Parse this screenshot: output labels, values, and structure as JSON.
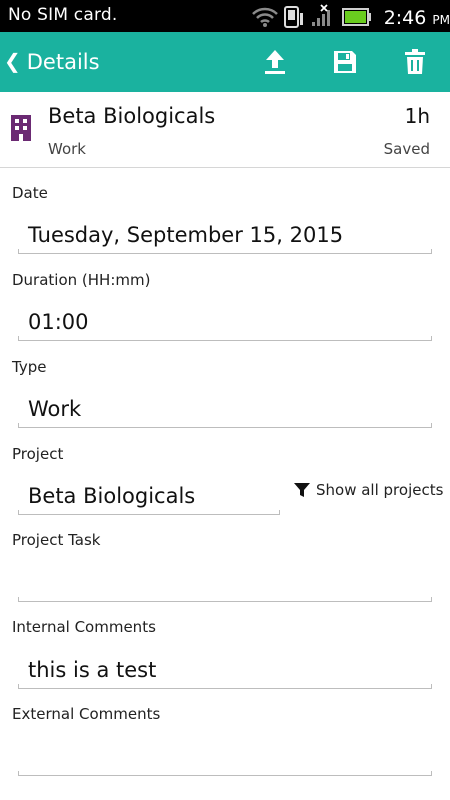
{
  "status_bar": {
    "carrier": "No SIM card.",
    "time": "2:46",
    "ampm": "PM"
  },
  "app_bar": {
    "title": "Details",
    "actions": [
      "upload-icon",
      "save-icon",
      "delete-icon"
    ],
    "color": "#1ab29f"
  },
  "summary": {
    "icon": "building-icon",
    "icon_color": "#6b2a73",
    "project": "Beta Biologicals",
    "type": "Work",
    "duration": "1h",
    "state": "Saved"
  },
  "form": {
    "date_label": "Date",
    "date_value": "Tuesday, September 15, 2015",
    "duration_label": "Duration (HH:mm)",
    "duration_value": "01:00",
    "type_label": "Type",
    "type_value": "Work",
    "project_label": "Project",
    "project_value": "Beta Biologicals",
    "show_all_projects": "Show all projects",
    "task_label": "Project Task",
    "task_value": "",
    "internal_label": "Internal Comments",
    "internal_value": "this is a test",
    "external_label": "External Comments",
    "external_value": ""
  }
}
